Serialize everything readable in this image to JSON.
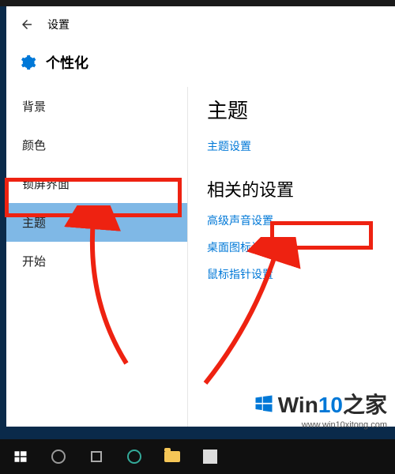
{
  "header": {
    "title": "设置"
  },
  "category": {
    "title": "个性化"
  },
  "sidebar": {
    "items": [
      {
        "label": "背景"
      },
      {
        "label": "颜色"
      },
      {
        "label": "锁屏界面"
      },
      {
        "label": "主题"
      },
      {
        "label": "开始"
      }
    ],
    "selected_index": 3
  },
  "content": {
    "section1_title": "主题",
    "theme_settings_link": "主题设置",
    "section2_title": "相关的设置",
    "links": [
      {
        "label": "高级声音设置"
      },
      {
        "label": "桌面图标设置"
      },
      {
        "label": "鼠标指针设置"
      }
    ]
  },
  "watermark": {
    "brand_prefix": "Win",
    "brand_mid": "10",
    "brand_suffix": "之家",
    "url": "www.win10xitong.com"
  },
  "colors": {
    "accent": "#0078d7",
    "highlight_box": "#e21",
    "sidebar_selected": "#7fb8e6"
  }
}
